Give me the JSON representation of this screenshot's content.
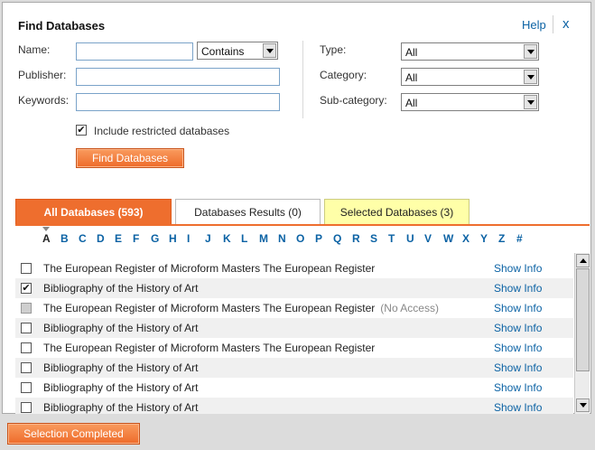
{
  "dialog": {
    "title": "Find Databases",
    "help_label": "Help",
    "close_label": "x"
  },
  "form": {
    "name_label": "Name:",
    "name_value": "",
    "match_select": "Contains",
    "publisher_label": "Publisher:",
    "publisher_value": "",
    "keywords_label": "Keywords:",
    "keywords_value": "",
    "type_label": "Type:",
    "type_value": "All",
    "category_label": "Category:",
    "category_value": "All",
    "subcategory_label": "Sub-category:",
    "subcategory_value": "All",
    "restricted_checkbox": {
      "label": "Include restricted databases",
      "checked": true
    },
    "find_button": "Find Databases"
  },
  "tabs": [
    {
      "label": "All Databases (593)",
      "state": "active"
    },
    {
      "label": "Databases Results (0)",
      "state": "normal"
    },
    {
      "label": "Selected Databases (3)",
      "state": "highlighted"
    }
  ],
  "alphabet": {
    "current": "A",
    "letters": [
      "A",
      "B",
      "C",
      "D",
      "E",
      "F",
      "G",
      "H",
      "I",
      "J",
      "K",
      "L",
      "M",
      "N",
      "O",
      "P",
      "Q",
      "R",
      "S",
      "T",
      "U",
      "V",
      "W",
      "X",
      "Y",
      "Z",
      "#"
    ]
  },
  "databases": [
    {
      "name": "The European Register of Microform Masters The European Register",
      "checked": false,
      "disabled": false,
      "note": "",
      "action": "Show Info"
    },
    {
      "name": "Bibliography of the History of Art",
      "checked": true,
      "disabled": false,
      "note": "",
      "action": "Show Info"
    },
    {
      "name": "The European Register of Microform Masters The European Register",
      "checked": false,
      "disabled": true,
      "note": "(No Access)",
      "action": "Show Info"
    },
    {
      "name": "Bibliography of the History of Art",
      "checked": false,
      "disabled": false,
      "note": "",
      "action": "Show Info"
    },
    {
      "name": "The European Register of Microform Masters The European Register",
      "checked": false,
      "disabled": false,
      "note": "",
      "action": "Show Info"
    },
    {
      "name": "Bibliography of the History of Art",
      "checked": false,
      "disabled": false,
      "note": "",
      "action": "Show Info"
    },
    {
      "name": "Bibliography of the History of Art",
      "checked": false,
      "disabled": false,
      "note": "",
      "action": "Show Info"
    },
    {
      "name": "Bibliography of the History of Art",
      "checked": false,
      "disabled": false,
      "note": "",
      "action": "Show Info"
    }
  ],
  "footer": {
    "completed_button": "Selection Completed"
  },
  "colors": {
    "accent": "#ee6e2e",
    "link": "#0b62a4",
    "selected_tab": "#ffffa8"
  },
  "icons": {
    "checkbox_check": "check-icon",
    "dropdown": "chevron-down-icon",
    "scroll_up": "arrow-up-icon",
    "scroll_down": "arrow-down-icon"
  }
}
